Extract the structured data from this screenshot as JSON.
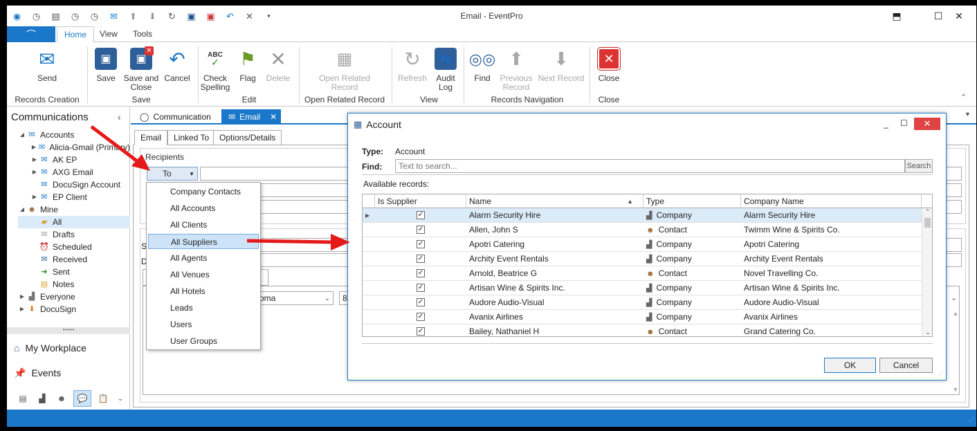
{
  "window": {
    "title": "Email - EventPro"
  },
  "ribbon": {
    "tabs": [
      "Home",
      "View",
      "Tools"
    ],
    "groups": {
      "records_creation": "Records Creation",
      "save": "Save",
      "edit": "Edit",
      "open_related": "Open Related Record",
      "view": "View",
      "nav": "Records Navigation",
      "close": "Close"
    },
    "buttons": {
      "send": "Send",
      "save": "Save",
      "save_close_1": "Save and",
      "save_close_2": "Close",
      "cancel": "Cancel",
      "check_1": "Check",
      "check_2": "Spelling",
      "flag": "Flag",
      "delete": "Delete",
      "open_rel_1": "Open Related",
      "open_rel_2": "Record",
      "refresh": "Refresh",
      "audit_1": "Audit",
      "audit_2": "Log",
      "find": "Find",
      "prev_1": "Previous",
      "prev_2": "Record",
      "next": "Next Record",
      "close": "Close"
    }
  },
  "nav": {
    "title": "Communications",
    "accounts": "Accounts",
    "account_items": [
      "Alicia-Gmail (Primary)",
      "AK EP",
      "AXG Email",
      "DocuSign Account",
      "EP Client"
    ],
    "mine": "Mine",
    "mine_items": [
      "All",
      "Drafts",
      "Scheduled",
      "Received",
      "Sent",
      "Notes"
    ],
    "everyone": "Everyone",
    "docusign": "DocuSign",
    "my_workplace": "My Workplace",
    "events": "Events"
  },
  "doc_tabs": {
    "communication": "Communication",
    "email": "Email"
  },
  "form": {
    "tabs": [
      "Email",
      "Linked To",
      "Options/Details"
    ],
    "recipients_label": "Recipients",
    "to_button": "To",
    "font_name": "oma",
    "font_size": "8"
  },
  "menu": {
    "items": [
      "Company Contacts",
      "All Accounts",
      "All Clients",
      "All Suppliers",
      "All Agents",
      "All Venues",
      "All Hotels",
      "Leads",
      "Users",
      "User Groups"
    ],
    "highlighted": "All Suppliers"
  },
  "dialog": {
    "title": "Account",
    "type_label": "Type:",
    "type_value": "Account",
    "find_label": "Find:",
    "find_placeholder": "Text to search...",
    "search_button": "Search",
    "available_label": "Available records:",
    "columns": [
      "Is Supplier",
      "Name",
      "Type",
      "Company Name"
    ],
    "rows": [
      {
        "name": "Alarm Security Hire",
        "type": "Company",
        "company": "Alarm Security Hire"
      },
      {
        "name": "Allen, John S",
        "type": "Contact",
        "company": "Twimm Wine & Spirits Co."
      },
      {
        "name": "Apotri Catering",
        "type": "Company",
        "company": "Apotri Catering"
      },
      {
        "name": "Archity Event Rentals",
        "type": "Company",
        "company": "Archity Event Rentals"
      },
      {
        "name": "Arnold, Beatrice G",
        "type": "Contact",
        "company": "Novel Travelling Co."
      },
      {
        "name": "Artisan Wine & Spirits Inc.",
        "type": "Company",
        "company": "Artisan Wine & Spirits Inc."
      },
      {
        "name": "Audore Audio-Visual",
        "type": "Company",
        "company": "Audore Audio-Visual"
      },
      {
        "name": "Avanix Airlines",
        "type": "Company",
        "company": "Avanix Airlines"
      },
      {
        "name": "Bailey, Nathaniel H",
        "type": "Contact",
        "company": "Grand Catering Co."
      }
    ],
    "ok": "OK",
    "cancel": "Cancel"
  }
}
